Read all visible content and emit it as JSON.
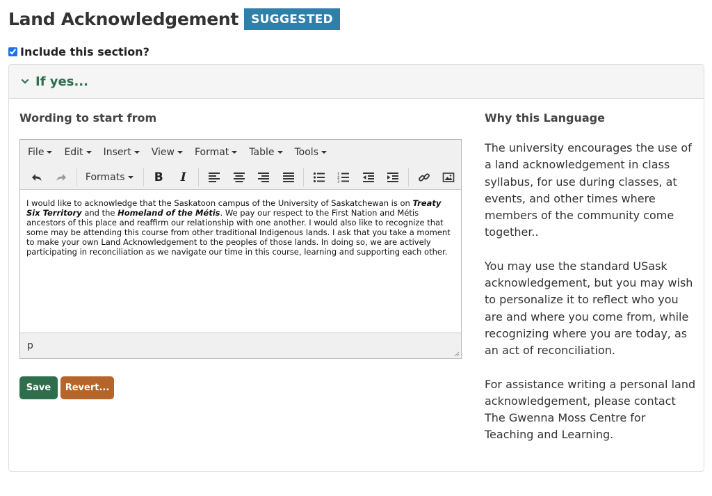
{
  "header": {
    "title": "Land Acknowledgement",
    "badge": "SUGGESTED"
  },
  "include": {
    "label": "Include this section?",
    "checked": true
  },
  "panel": {
    "title": "If yes..."
  },
  "left": {
    "heading": "Wording to start from"
  },
  "editor": {
    "menus": [
      "File",
      "Edit",
      "Insert",
      "View",
      "Format",
      "Table",
      "Tools"
    ],
    "formats_label": "Formats",
    "bold_label": "B",
    "italic_label": "I",
    "content": {
      "t1": "I would like to acknowledge that the Saskatoon campus of the University of Saskatchewan is on ",
      "b1": "Treaty Six Territory",
      "t2": " and the ",
      "b2": "Homeland of the Métis",
      "t3": ". We pay our respect to the First Nation and Métis ancestors of this place and reaffirm our relationship with one another. I would also like to recognize that some may be attending this course from other traditional Indigenous lands. I ask that you take a moment to make your own Land Acknowledgement to the peoples of those lands. In doing so, we are actively participating in reconciliation as we navigate our time in this course, learning and supporting each other."
    },
    "status": "p"
  },
  "buttons": {
    "save": "Save",
    "revert": "Revert..."
  },
  "right": {
    "heading": "Why this Language",
    "paragraphs": [
      "The university encourages the use of a land acknowledgement in class syllabus, for use during classes, at events, and other times where members of the community come together..",
      "You may use the standard USask acknowledgement, but you may wish to personalize it to reflect who you are and where you come from, while recognizing where you are today, as an act of reconciliation.",
      "For assistance writing a personal land acknowledgement, please contact The Gwenna Moss Centre for Teaching and Learning."
    ]
  },
  "colors": {
    "badge": "#2f7fa9",
    "accent_green": "#2e6e4d",
    "revert": "#b5652a"
  }
}
